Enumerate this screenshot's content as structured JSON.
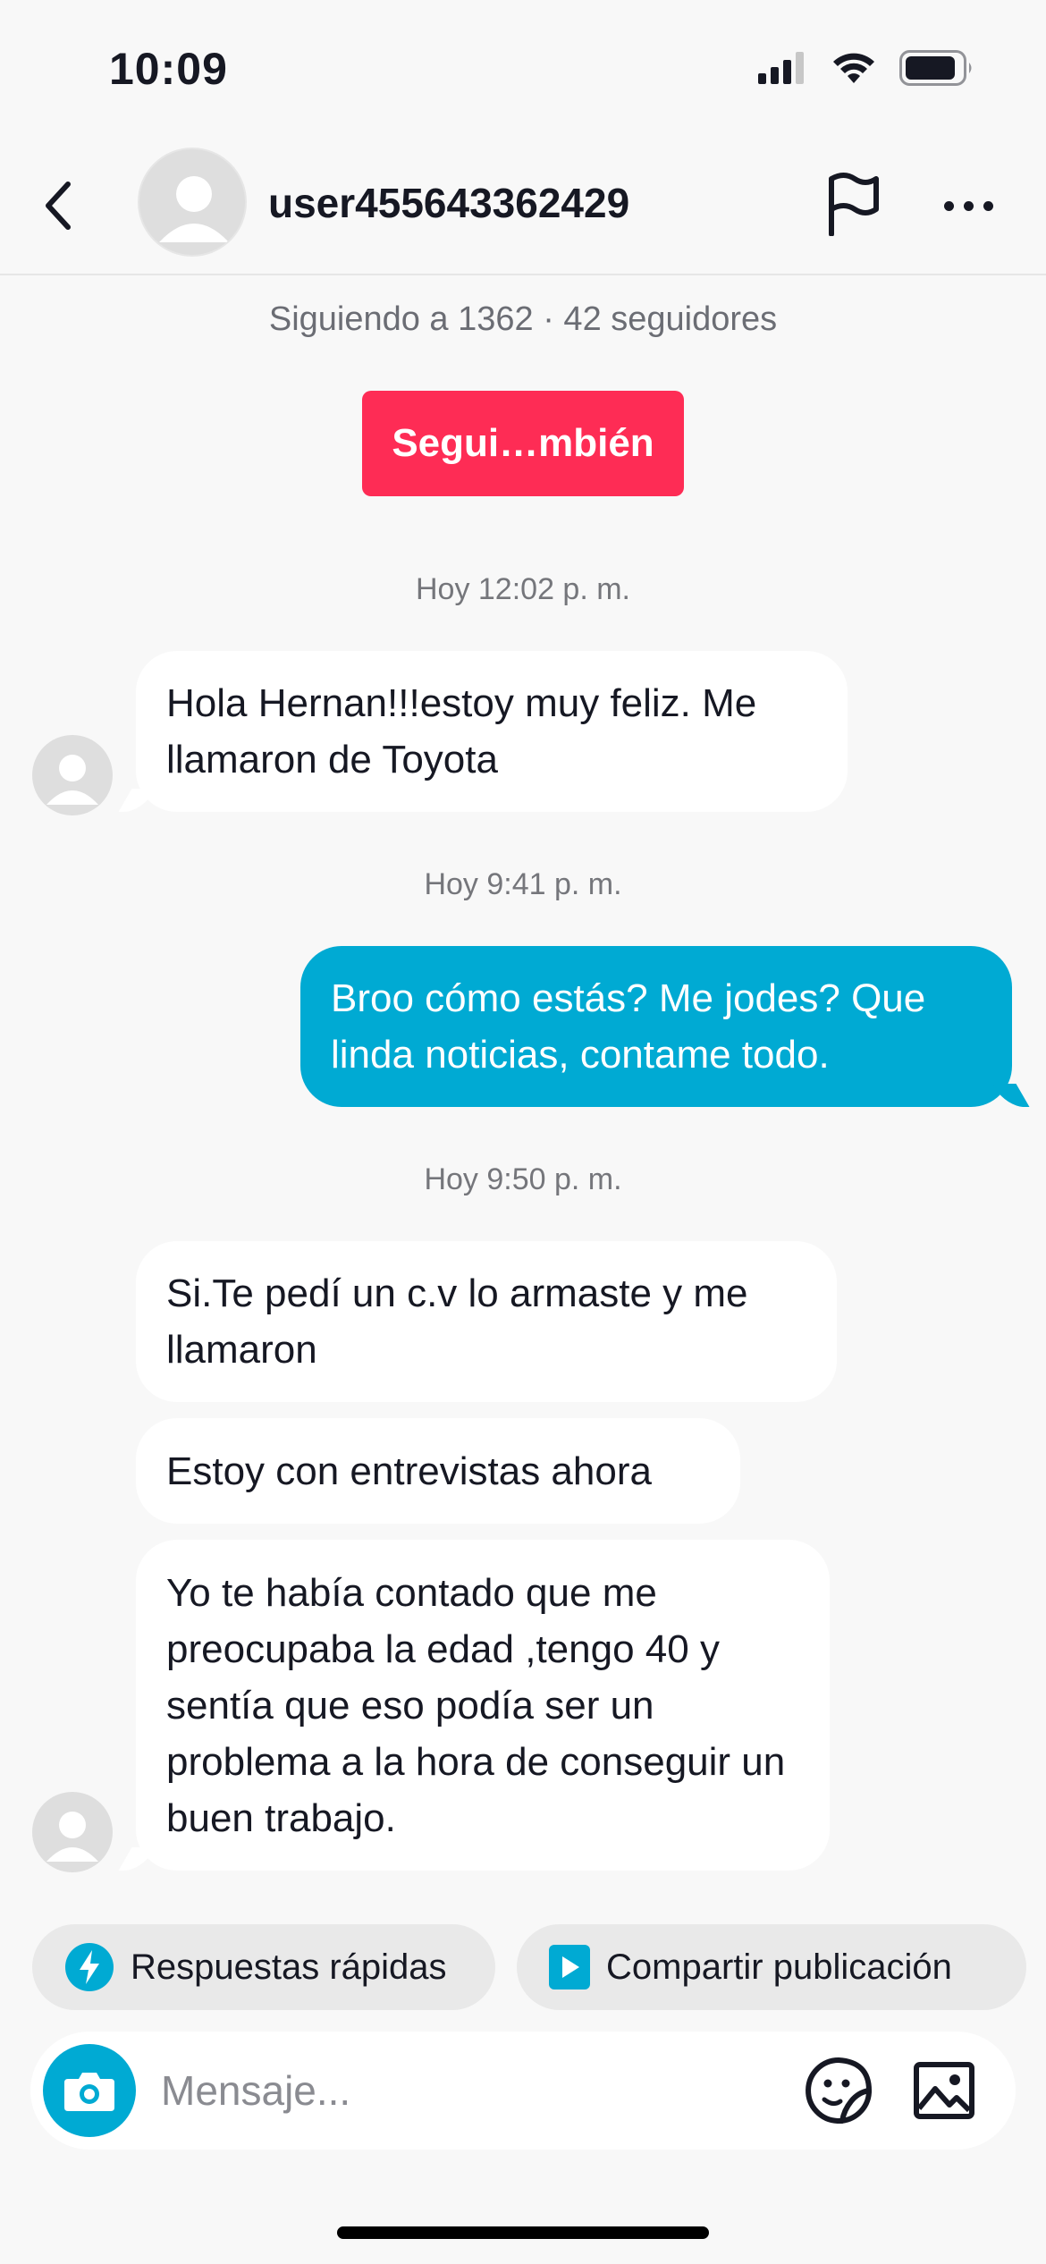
{
  "status_bar": {
    "time": "10:09"
  },
  "header": {
    "username": "user455643362429"
  },
  "profile": {
    "follow_info": "Siguiendo a 1362 · 42 seguidores",
    "follow_button": "Segui…mbién"
  },
  "messages": [
    {
      "timestamp": "Hoy 12:02 p. m."
    },
    {
      "text": "Hola Hernan!!!estoy muy feliz. Me llamaron de Toyota"
    },
    {
      "timestamp": "Hoy 9:41 p. m."
    },
    {
      "text": "Broo cómo estás? Me jodes? Que linda noticias, contame todo."
    },
    {
      "timestamp": "Hoy 9:50 p. m."
    },
    {
      "text": "Si.Te pedí un c.v lo armaste y me llamaron"
    },
    {
      "text": "Estoy con entrevistas ahora"
    },
    {
      "text": "Yo te había contado que me preocupaba la edad ,tengo 40 y sentía que eso podía ser un problema a la hora de conseguir un buen trabajo."
    }
  ],
  "quick_actions": {
    "quick_replies": "Respuestas rápidas",
    "share_post": "Compartir publicación"
  },
  "composer": {
    "placeholder": "Mensaje..."
  },
  "colors": {
    "accent_red": "#fe2c55",
    "outgoing_bubble": "#00aad3",
    "incoming_bubble": "#ffffff",
    "background": "#f8f8f8"
  },
  "icons": [
    "back-icon",
    "flag-icon",
    "more-icon",
    "lightning-icon",
    "play-icon",
    "camera-icon",
    "sticker-icon",
    "image-icon"
  ]
}
